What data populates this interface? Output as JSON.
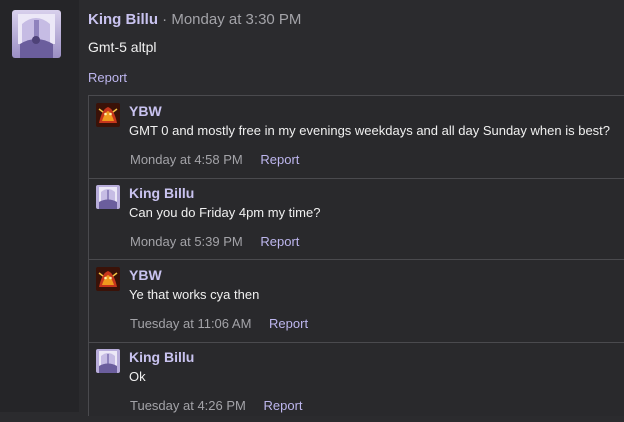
{
  "post": {
    "author": "King Billu",
    "separator": "·",
    "time": "Monday at 3:30 PM",
    "body": "Gmt-5 altpl",
    "report_label": "Report",
    "avatar_icon": "castle-window-avatar-icon"
  },
  "replies": [
    {
      "author": "YBW",
      "text": "GMT 0 and mostly free in my evenings weekdays and all day Sunday when is best?",
      "time": "Monday at 4:58 PM",
      "report_label": "Report",
      "avatar_icon": "dragon-avatar-icon"
    },
    {
      "author": "King Billu",
      "text": "Can you do Friday 4pm my time?",
      "time": "Monday at 5:39 PM",
      "report_label": "Report",
      "avatar_icon": "castle-window-avatar-icon"
    },
    {
      "author": "YBW",
      "text": "Ye that works cya then",
      "time": "Tuesday at 11:06 AM",
      "report_label": "Report",
      "avatar_icon": "dragon-avatar-icon"
    },
    {
      "author": "King Billu",
      "text": "Ok",
      "time": "Tuesday at 4:26 PM",
      "report_label": "Report",
      "avatar_icon": "castle-window-avatar-icon"
    }
  ],
  "colors": {
    "author": "#c9c3f0",
    "link": "#bdb6ee",
    "muted": "#a3a3a8",
    "background": "#2b2b2e"
  }
}
